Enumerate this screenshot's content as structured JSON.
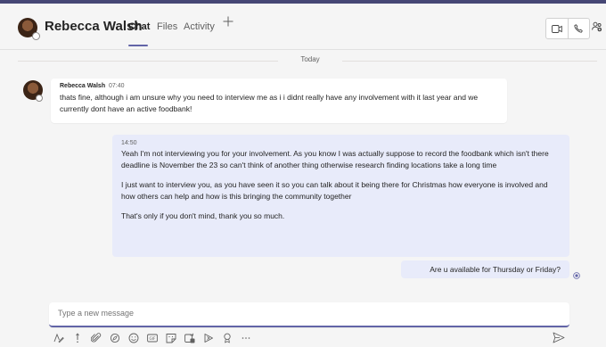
{
  "header": {
    "contact_name": "Rebecca Walsh",
    "tabs": [
      {
        "label": "Chat",
        "active": true
      },
      {
        "label": "Files",
        "active": false
      },
      {
        "label": "Activity",
        "active": false
      }
    ],
    "add_tab_icon": "plus-icon",
    "actions": [
      "video-call-icon",
      "audio-call-icon",
      "people-icon"
    ],
    "accent_color": "#6264a7"
  },
  "conversation": {
    "date_divider": "Today",
    "messages": [
      {
        "direction": "incoming",
        "sender": "Rebecca Walsh",
        "time": "07:40",
        "text": "thats fine, although i am unsure why you need to interview me as i i didnt really have any involvement with it last year and we currently dont have an active foodbank!"
      },
      {
        "direction": "outgoing",
        "time": "14:50",
        "paragraphs": [
          "Yeah I'm not interviewing you for your involvement. As you know I was actually suppose to record the foodbank which isn't there deadline is November the 23 so can't think of another thing otherwise research finding locations take a long time",
          "I just want to interview you, as you have seen it so you can talk about it being there for Christmas how everyone is involved and how others can help and how is this bringing the community together",
          "That's only if you don't mind, thank you so much."
        ]
      },
      {
        "direction": "outgoing",
        "text": "Are u available for Thursday or Friday?"
      }
    ]
  },
  "composer": {
    "placeholder": "Type a new message",
    "toolbar_icons": [
      "format-icon",
      "important-icon",
      "attach-icon",
      "loop-icon",
      "emoji-icon",
      "gif-icon",
      "sticker-icon",
      "meet-now-icon",
      "stream-icon",
      "praise-icon",
      "more-icon"
    ],
    "send_icon": "send-icon"
  }
}
